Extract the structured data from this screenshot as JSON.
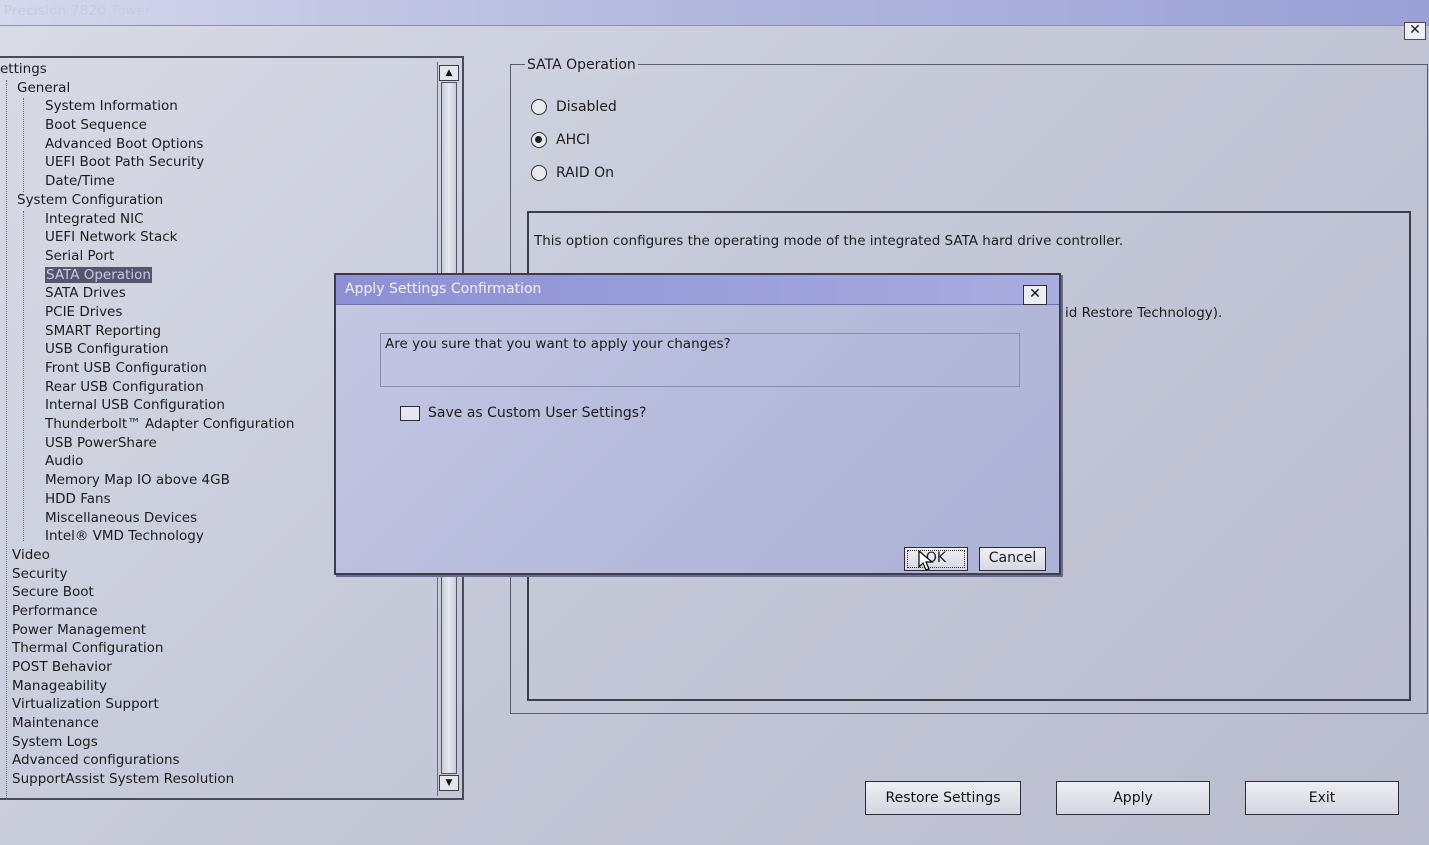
{
  "window": {
    "title": "Precision 7820 Tower"
  },
  "tree": {
    "root": "ettings",
    "nodes": [
      {
        "label": "General",
        "level": 1
      },
      {
        "label": "System Information",
        "level": 2
      },
      {
        "label": "Boot Sequence",
        "level": 2
      },
      {
        "label": "Advanced Boot Options",
        "level": 2
      },
      {
        "label": "UEFI Boot Path Security",
        "level": 2
      },
      {
        "label": "Date/Time",
        "level": 2
      },
      {
        "label": "System Configuration",
        "level": 1
      },
      {
        "label": "Integrated NIC",
        "level": 2
      },
      {
        "label": "UEFI Network Stack",
        "level": 2
      },
      {
        "label": "Serial Port",
        "level": 2
      },
      {
        "label": "SATA Operation",
        "level": 2,
        "selected": true
      },
      {
        "label": "SATA Drives",
        "level": 2
      },
      {
        "label": "PCIE Drives",
        "level": 2
      },
      {
        "label": "SMART Reporting",
        "level": 2
      },
      {
        "label": "USB Configuration",
        "level": 2
      },
      {
        "label": "Front USB Configuration",
        "level": 2
      },
      {
        "label": "Rear USB Configuration",
        "level": 2
      },
      {
        "label": "Internal USB Configuration",
        "level": 2
      },
      {
        "label": "Thunderbolt™ Adapter Configuration",
        "level": 2
      },
      {
        "label": "USB PowerShare",
        "level": 2
      },
      {
        "label": "Audio",
        "level": 2
      },
      {
        "label": "Memory Map IO above 4GB",
        "level": 2
      },
      {
        "label": "HDD Fans",
        "level": 2
      },
      {
        "label": "Miscellaneous Devices",
        "level": 2
      },
      {
        "label": "Intel® VMD Technology",
        "level": 2
      },
      {
        "label": "Video",
        "level": 0
      },
      {
        "label": "Security",
        "level": 0
      },
      {
        "label": "Secure Boot",
        "level": 0
      },
      {
        "label": "Performance",
        "level": 0
      },
      {
        "label": "Power Management",
        "level": 0
      },
      {
        "label": "Thermal Configuration",
        "level": 0
      },
      {
        "label": "POST Behavior",
        "level": 0
      },
      {
        "label": "Manageability",
        "level": 0
      },
      {
        "label": "Virtualization Support",
        "level": 0
      },
      {
        "label": "Maintenance",
        "level": 0
      },
      {
        "label": "System Logs",
        "level": 0
      },
      {
        "label": "Advanced configurations",
        "level": 0
      },
      {
        "label": "SupportAssist System Resolution",
        "level": 0
      }
    ]
  },
  "sata": {
    "group_title": "SATA Operation",
    "options": [
      {
        "label": "Disabled",
        "selected": false
      },
      {
        "label": "AHCI",
        "selected": true
      },
      {
        "label": "RAID On",
        "selected": false
      }
    ],
    "help_line_1": "This option configures the operating mode of the integrated SATA hard drive controller.",
    "help_line_partial": "id Restore Technology)."
  },
  "buttons": {
    "restore": "Restore Settings",
    "apply": "Apply",
    "exit": "Exit"
  },
  "dialog": {
    "title": "Apply Settings Confirmation",
    "message": "Are you sure that you want to apply your changes?",
    "checkbox_label": "Save as Custom User Settings?",
    "checkbox_checked": false,
    "ok": "OK",
    "cancel": "Cancel"
  }
}
